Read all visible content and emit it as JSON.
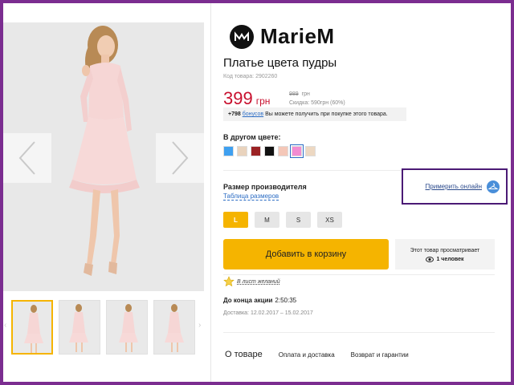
{
  "brand": {
    "name": "MarieM"
  },
  "product": {
    "title": "Платье цвета пудры",
    "sku": "Код товара: 2902260",
    "price": "399",
    "currency": "грн",
    "old_price": "989",
    "old_currency": "грн",
    "discount": "Скидка: 590грн (60%)"
  },
  "bonus": {
    "amount": "+798",
    "link": "бонусов",
    "text": "Вы можете получить при покупке этого товара."
  },
  "colors": {
    "label": "В другом цвете:",
    "swatches": [
      "#3fa0f0",
      "#e9d3bd",
      "#9b2224",
      "#111111",
      "#f4c7b8",
      "#f28cd2",
      "#edd8c2"
    ],
    "selected_index": 5
  },
  "size": {
    "label": "Размер производителя",
    "table_link": "Таблица размеров",
    "try_online": "Примерить онлайн",
    "options": [
      "L",
      "M",
      "S",
      "XS"
    ],
    "selected": "L"
  },
  "cart": {
    "button": "Добавить в корзину"
  },
  "viewers": {
    "line1": "Этот товар просматривает",
    "count": "1 человек"
  },
  "wishlist": {
    "label": "В лист желаний"
  },
  "promo": {
    "label": "До конца акции",
    "time": "2:50:35"
  },
  "delivery": {
    "text": "Доставка: 12.02.2017 – 15.02.2017"
  },
  "tabs": [
    "О товаре",
    "Оплата и доставка",
    "Возврат и гарантии"
  ],
  "accent_color": "#f5b400",
  "price_color": "#c8102e",
  "highlight_border_color": "#4b1a75",
  "icons": [
    "chevron-left-icon",
    "chevron-right-icon",
    "hanger-icon",
    "eye-icon",
    "star-icon",
    "brand-logo-icon"
  ]
}
